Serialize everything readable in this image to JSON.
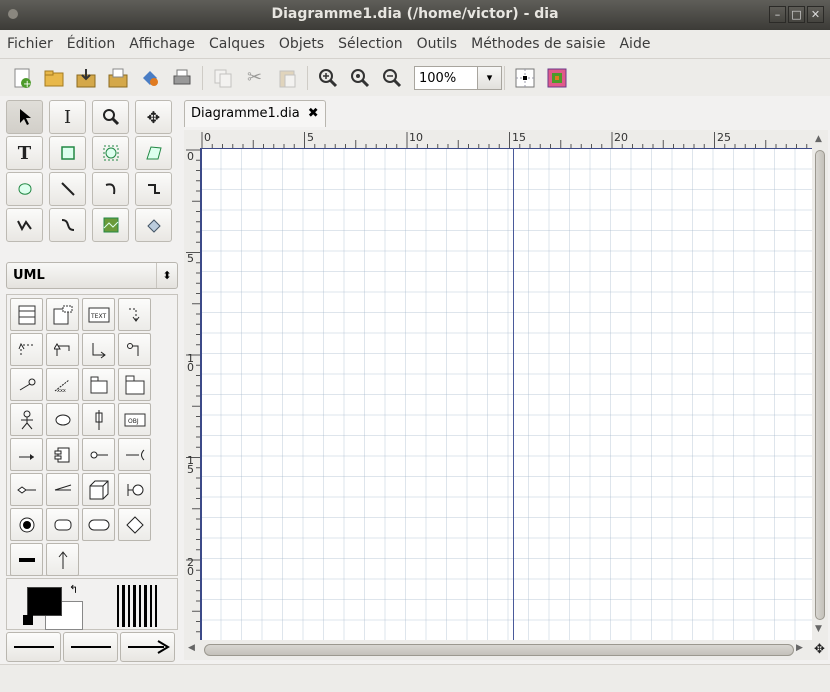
{
  "window": {
    "title": "Diagramme1.dia (/home/victor) - dia"
  },
  "menu": [
    "Fichier",
    "Édition",
    "Affichage",
    "Calques",
    "Objets",
    "Sélection",
    "Outils",
    "Méthodes de saisie",
    "Aide"
  ],
  "toolbar": {
    "zoom_value": "100%"
  },
  "sheet_selector": {
    "value": "UML"
  },
  "document_tab": {
    "label": "Diagramme1.dia",
    "close_glyph": "✖"
  },
  "ruler": {
    "horizontal": [
      "0",
      "5",
      "10",
      "15",
      "20",
      "25"
    ],
    "vertical": [
      "0",
      "5",
      "10",
      "15",
      "20"
    ]
  },
  "uml_shape_labels": {
    "text_shape": "TEXT",
    "object_shape": "OBJ",
    "class_shape": "xxx"
  },
  "colors": {
    "foreground": "#000000",
    "background": "#ffffff",
    "page_border": "#3c4a88"
  }
}
